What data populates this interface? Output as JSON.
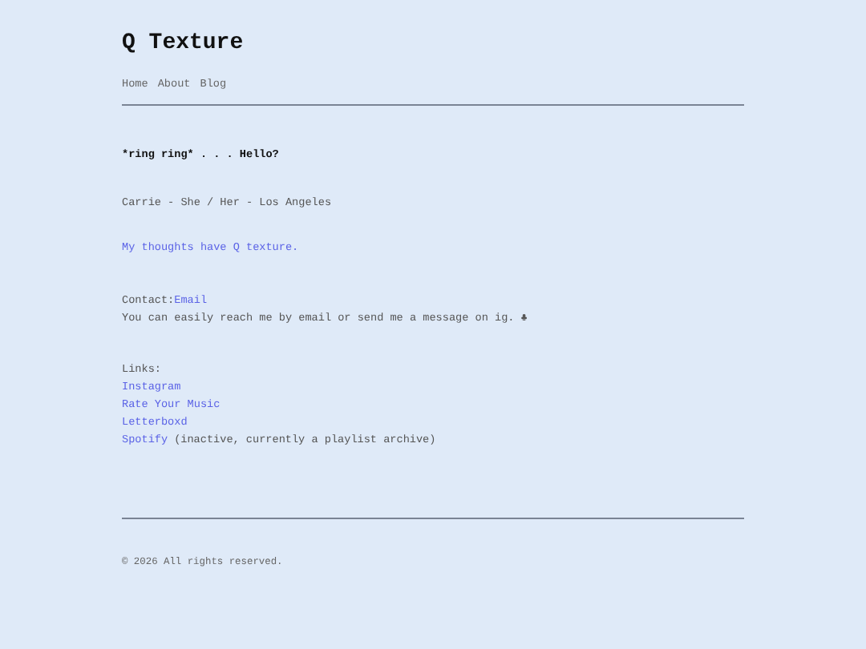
{
  "site_title": "Q Texture",
  "nav": [
    "Home",
    "About",
    "Blog"
  ],
  "greeting": "*ring ring* . . . Hello?",
  "byline": "Carrie - She / Her - Los Angeles",
  "tagline_link": "My thoughts have Q texture.",
  "contact": {
    "label": "Contact:",
    "link": "Email",
    "note": "You can easily reach me by email or send me a message on ig. ♣"
  },
  "links": {
    "label": "Links:",
    "items": [
      {
        "text": "Instagram"
      },
      {
        "text": "Rate Your Music"
      },
      {
        "text": "Letterboxd"
      },
      {
        "text": "Spotify",
        "note": "(inactive, currently a playlist archive)"
      }
    ]
  },
  "footer": "© 2026 All rights reserved."
}
